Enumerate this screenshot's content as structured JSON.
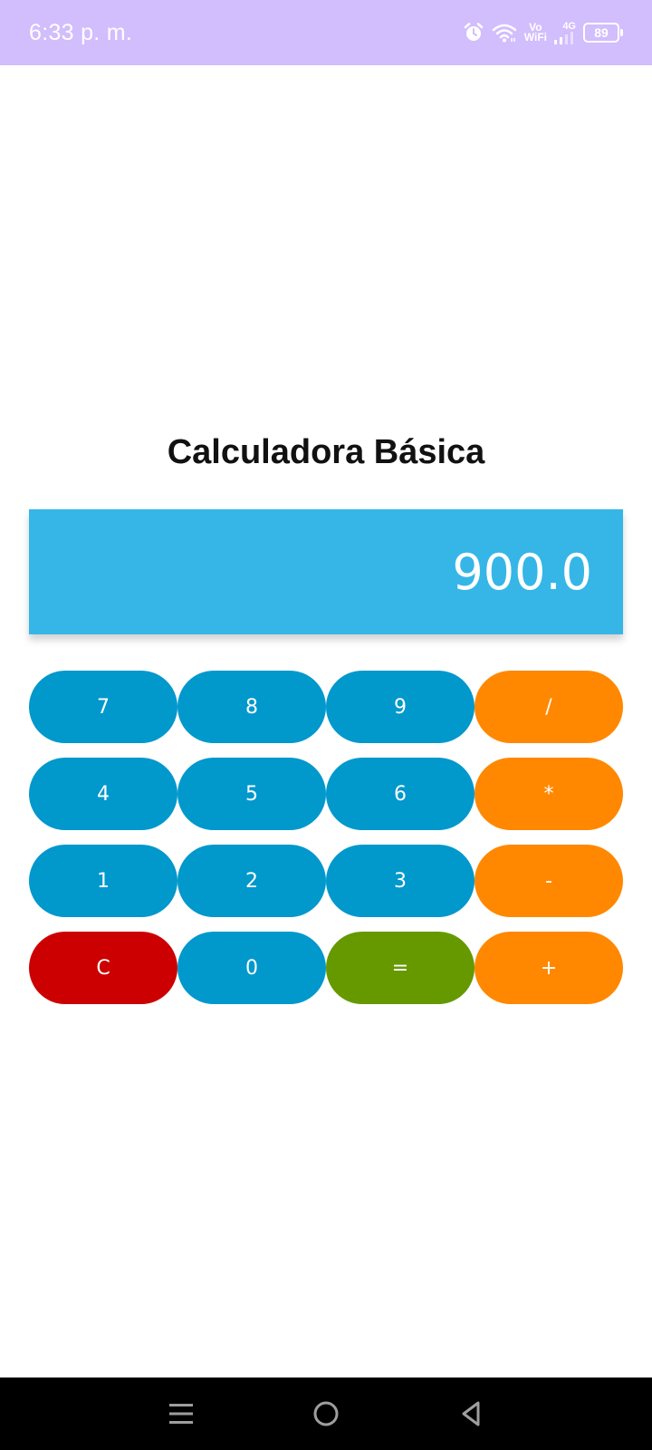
{
  "status_bar": {
    "time": "6:33 p. m.",
    "vowifi_top": "Vo",
    "vowifi_bottom": "WiFi",
    "network": "4G",
    "battery": "89"
  },
  "app": {
    "title": "Calculadora Básica",
    "display_value": "900.0"
  },
  "keypad": {
    "rows": [
      [
        {
          "label": "7",
          "kind": "num"
        },
        {
          "label": "8",
          "kind": "num"
        },
        {
          "label": "9",
          "kind": "num"
        },
        {
          "label": "/",
          "kind": "op"
        }
      ],
      [
        {
          "label": "4",
          "kind": "num"
        },
        {
          "label": "5",
          "kind": "num"
        },
        {
          "label": "6",
          "kind": "num"
        },
        {
          "label": "*",
          "kind": "op"
        }
      ],
      [
        {
          "label": "1",
          "kind": "num"
        },
        {
          "label": "2",
          "kind": "num"
        },
        {
          "label": "3",
          "kind": "num"
        },
        {
          "label": "-",
          "kind": "op"
        }
      ],
      [
        {
          "label": "C",
          "kind": "clear"
        },
        {
          "label": "0",
          "kind": "num"
        },
        {
          "label": "=",
          "kind": "equals"
        },
        {
          "label": "+",
          "kind": "op"
        }
      ]
    ]
  },
  "colors": {
    "status_bar": "#d2bdfd",
    "display": "#35b6e6",
    "number_key": "#0198cc",
    "operator_key": "#ff8800",
    "clear_key": "#cc0000",
    "equals_key": "#669900"
  },
  "nav_bar": {
    "icons": [
      "menu-icon",
      "home-icon",
      "back-icon"
    ]
  }
}
